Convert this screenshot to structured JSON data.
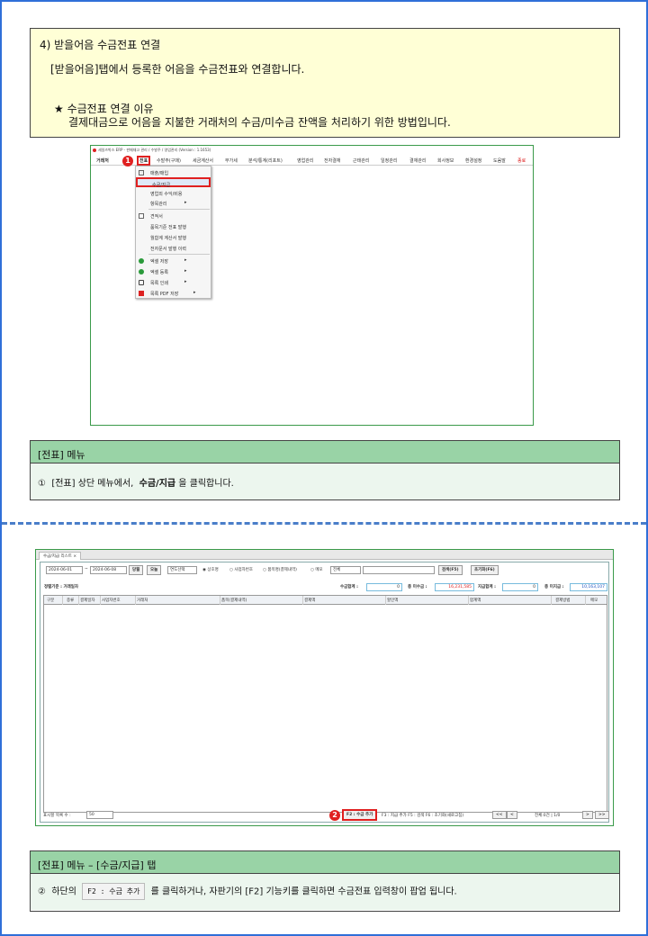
{
  "note": {
    "heading": "4) 받을어음 수금전표 연결",
    "desc": "[받을어음]탭에서 등록한 어음을 수금전표와 연결합니다.",
    "reason_title": "★ 수금전표 연결 이유",
    "reason_text": "결제대금으로 어음을 지불한 거래처의 수금/미수금 잔액을 처리하기 위한 방법입니다."
  },
  "shot1": {
    "title": "세일즈박스 ERP - 판매재고 관리 / 수발주 / 영업관리 (Version : 1.1653)",
    "menu": [
      "거래처",
      "전표",
      "수발주(구매)",
      "세금계산서",
      "부가세",
      "분석/통계(리포트)",
      "영업관리",
      "전자결재",
      "근태관리",
      "일정관리",
      "결재관리",
      "회사정보",
      "환경설정",
      "도움말",
      "종료"
    ],
    "badge": "1",
    "dropdown": [
      {
        "label": "매출/매입",
        "icon": "doc-icon",
        "arrow": ""
      },
      {
        "label": "수금/지급",
        "icon": "",
        "arrow": ""
      },
      {
        "label": "영업외 수익/비용",
        "icon": "",
        "arrow": ""
      },
      {
        "label": "항목관리",
        "icon": "",
        "arrow": "▸"
      },
      {
        "label": "견적서",
        "icon": "doc-icon",
        "arrow": ""
      },
      {
        "label": "품목기준 전표 발행",
        "icon": "",
        "arrow": ""
      },
      {
        "label": "월합계 계산서 발행",
        "icon": "",
        "arrow": ""
      },
      {
        "label": "전자문서 발행 이력",
        "icon": "",
        "arrow": ""
      },
      {
        "label": "엑셀 저장",
        "icon": "excel-icon",
        "arrow": "▸"
      },
      {
        "label": "엑셀 등록",
        "icon": "excel-icon",
        "arrow": "▸"
      },
      {
        "label": "목록 인쇄",
        "icon": "print-icon",
        "arrow": "▸"
      },
      {
        "label": "목록 PDF 저장",
        "icon": "pdf-icon",
        "arrow": "▸"
      }
    ]
  },
  "cap1": {
    "header": "[전표] 메뉴",
    "num": "①",
    "pre": "[전표] 상단 메뉴에서,",
    "bold": "수금/지급",
    "post": "을 클릭합니다."
  },
  "shot2": {
    "tab": "수금/지급 리스트",
    "tab_close": "×",
    "date_from": "2024-06-01",
    "tilde": "~",
    "date_to": "2024-06-08",
    "btn_month": "당월",
    "btn_today": "오늘",
    "period_select": "연도선택",
    "radio1": "◉ 상호명",
    "radio2": "○ 사업자번호",
    "radio3": "○ 품목명(결제내역)",
    "radio4": "○ 메모",
    "filter_select": "전체",
    "search_btn": "검색(F5)",
    "reset_btn": "초기화(F6)",
    "sort_label": "정렬기준 : 거래일자",
    "sum_collect_label": "수금합계 :",
    "sum_collect": "0",
    "total_unpaid_label": "총 미수금 :",
    "total_unpaid": "16,231,585",
    "sum_pay_label": "지급합계 :",
    "sum_pay": "0",
    "total_unpay_label": "총 미지급 :",
    "total_unpay": "10,163,107",
    "columns": [
      "구분",
      "종류",
      "결제일자",
      "사업자번호",
      "거래처",
      "품목(결제내역)",
      "결제액",
      "할인액",
      "합계액",
      "결제방법",
      "메모"
    ],
    "rows_label": "표시할 목록 수 :",
    "rows_value": "50",
    "badge": "2",
    "f2": "F2 : 수금 추가",
    "f_rest": "F3 : 지급 추가   F5 : 검색   F6 : 초기화(새로고침)",
    "nav_first": "<<",
    "nav_prev": "<",
    "page": "전체:0건 | 1/0",
    "nav_next": ">",
    "nav_last": ">>"
  },
  "cap2": {
    "header": "[전표] 메뉴 – [수금/지급] 탭",
    "num": "②",
    "pre": "하단의",
    "key": "F2 : 수금 추가",
    "post": "를 클릭하거나, 자판기의 [F2] 기능키를 클릭하면 수금전표 입력창이 팝업 됩니다."
  }
}
